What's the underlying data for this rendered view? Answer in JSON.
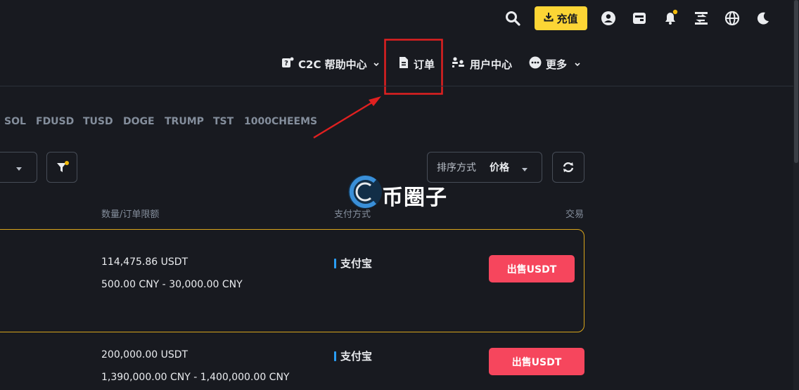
{
  "topbar": {
    "deposit_label": "充值",
    "icons": [
      "search-icon",
      "download-icon",
      "user-icon",
      "wallet-icon",
      "bell-icon",
      "transfer-icon",
      "globe-icon",
      "moon-icon"
    ],
    "accent_color": "#fcd535",
    "notification_dot_color": "#f0b90b"
  },
  "nav": {
    "help_center": "C2C 帮助中心",
    "orders": "订单",
    "user_center": "用户中心",
    "more": "更多"
  },
  "coin_tabs": [
    "SOL",
    "FDUSD",
    "TUSD",
    "DOGE",
    "TRUMP",
    "TST",
    "1000CHEEMS"
  ],
  "filters": {
    "sort_label": "排序方式",
    "sort_value": "价格"
  },
  "watermark": {
    "text": "币圈子"
  },
  "table": {
    "headers": {
      "amount_limit": "数量/订单限额",
      "payment": "支付方式",
      "trade": "交易"
    },
    "rows": [
      {
        "quantity": "114,475.86 USDT",
        "limit": "500.00 CNY - 30,000.00 CNY",
        "payment": "支付宝",
        "action": "出售USDT"
      },
      {
        "quantity": "200,000.00 USDT",
        "limit": "1,390,000.00 CNY - 1,400,000.00 CNY",
        "payment": "支付宝",
        "action": "出售USDT"
      }
    ]
  },
  "annotation": {
    "color": "#e02020"
  },
  "colors": {
    "background": "#181a20",
    "sell": "#f6465d",
    "alipay": "#2a9df4",
    "highlight_border": "#d9a51b"
  }
}
